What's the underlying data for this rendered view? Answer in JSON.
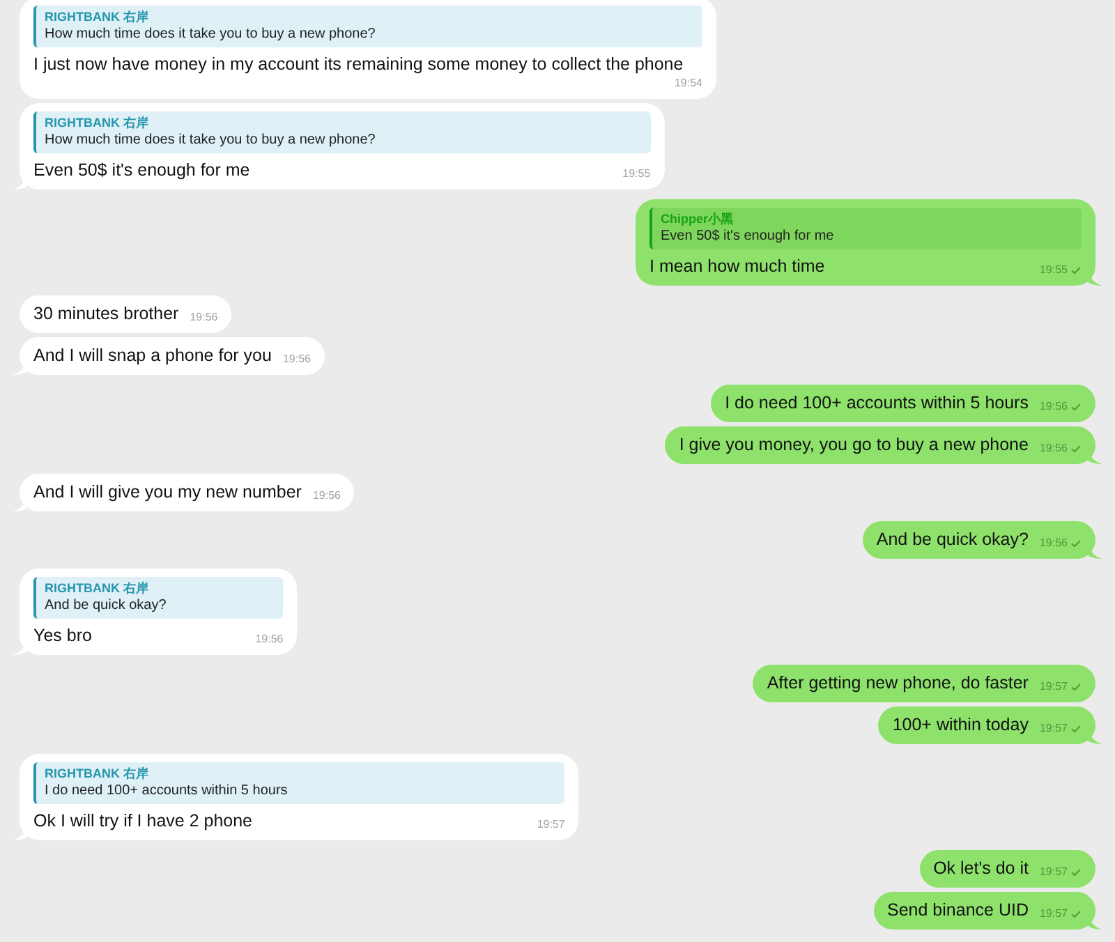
{
  "messages": [
    {
      "kind": "in",
      "tail": false,
      "reply": {
        "author": "RIGHTBANK 右岸",
        "text": "How much time does it take you to buy a new phone?"
      },
      "text": "I just now have money in my account its remaining some money to collect the phone",
      "time": "19:54"
    },
    {
      "kind": "in",
      "tail": true,
      "reply": {
        "author": "RIGHTBANK 右岸",
        "text": "How much time does it take you to buy a new phone?"
      },
      "text": "Even 50$ it's enough for me",
      "time": "19:55"
    },
    {
      "kind": "out",
      "tail": true,
      "reply": {
        "author": "Chipper小黑",
        "text": "Even 50$ it's enough for me"
      },
      "text": "I mean how much time",
      "time": "19:55"
    },
    {
      "kind": "in",
      "tail": false,
      "text": "30 minutes brother",
      "time": "19:56"
    },
    {
      "kind": "in",
      "tail": true,
      "text": "And I will snap a phone for you",
      "time": "19:56"
    },
    {
      "kind": "out",
      "tail": false,
      "text": "I do need 100+ accounts within 5 hours",
      "time": "19:56"
    },
    {
      "kind": "out",
      "tail": true,
      "text": "I give you money, you go to buy a new phone",
      "time": "19:56"
    },
    {
      "kind": "in",
      "tail": true,
      "text": "And I will give you my new number",
      "time": "19:56"
    },
    {
      "kind": "out",
      "tail": true,
      "text": "And be quick okay?",
      "time": "19:56"
    },
    {
      "kind": "in",
      "tail": true,
      "reply": {
        "author": "RIGHTBANK 右岸",
        "text": "And be quick okay?"
      },
      "text": "Yes bro",
      "time": "19:56"
    },
    {
      "kind": "out",
      "tail": false,
      "text": "After getting new phone, do faster",
      "time": "19:57"
    },
    {
      "kind": "out",
      "tail": true,
      "text": "100+ within today",
      "time": "19:57"
    },
    {
      "kind": "in",
      "tail": true,
      "reply": {
        "author": "RIGHTBANK 右岸",
        "text": "I do need 100+ accounts within 5 hours"
      },
      "text": "Ok I will try if I have 2 phone",
      "time": "19:57"
    },
    {
      "kind": "out",
      "tail": false,
      "text": "Ok let's do it",
      "time": "19:57"
    },
    {
      "kind": "out",
      "tail": true,
      "text": "Send binance UID",
      "time": "19:57"
    }
  ]
}
